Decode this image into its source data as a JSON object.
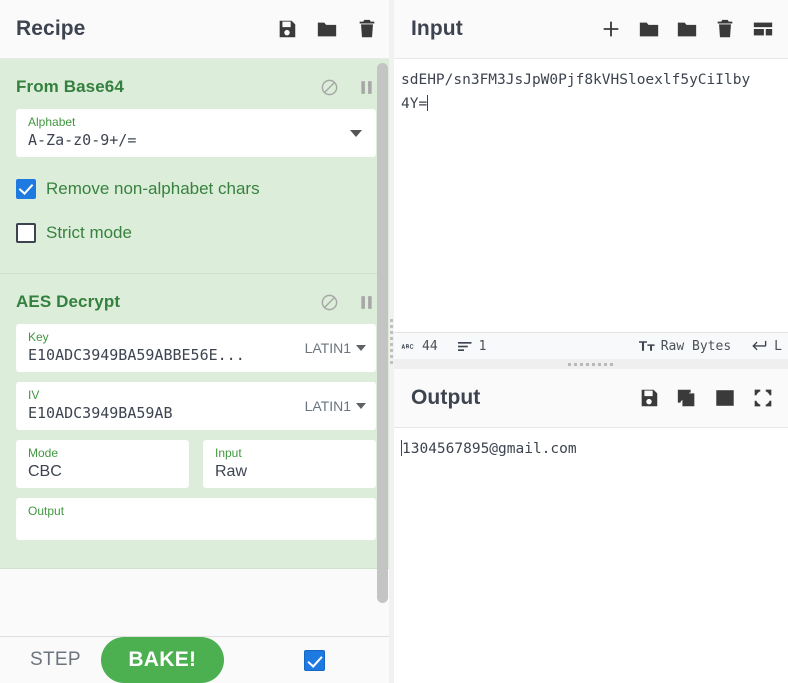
{
  "recipe": {
    "title": "Recipe",
    "title_icons": [
      {
        "name": "save-recipe-icon",
        "glyph": "floppy"
      },
      {
        "name": "load-recipe-icon",
        "glyph": "folder"
      },
      {
        "name": "clear-recipe-icon",
        "glyph": "trash"
      }
    ],
    "operations": [
      {
        "name": "From Base64",
        "disable_label": "disable-operation-icon",
        "pause_label": "breakpoint-icon",
        "args": [
          {
            "type": "select",
            "label": "Alphabet",
            "value": "A-Za-z0-9+/="
          },
          {
            "type": "checkbox",
            "label": "Remove non-alphabet chars",
            "checked": true
          },
          {
            "type": "checkbox",
            "label": "Strict mode",
            "checked": false
          }
        ]
      },
      {
        "name": "AES Decrypt",
        "disable_label": "disable-operation-icon",
        "pause_label": "breakpoint-icon",
        "args": [
          {
            "type": "toggle-string",
            "label": "Key",
            "value": "E10ADC3949BA59ABBE56E...",
            "encoding": "LATIN1"
          },
          {
            "type": "toggle-string",
            "label": "IV",
            "value": "E10ADC3949BA59AB",
            "encoding": "LATIN1"
          },
          {
            "type": "select",
            "label": "Mode",
            "value": "CBC"
          },
          {
            "type": "select",
            "label": "Input",
            "value": "Raw"
          },
          {
            "type": "select",
            "label": "Output",
            "value": ""
          }
        ]
      }
    ]
  },
  "controls": {
    "step_label": "STEP",
    "bake_label": "BAKE!",
    "auto_bake_name": "auto-bake-checkbox",
    "auto_bake_checked": true
  },
  "input": {
    "title": "Input",
    "title_icons": [
      {
        "name": "add-input-tab-icon",
        "glyph": "plus"
      },
      {
        "name": "open-file-icon",
        "glyph": "folder"
      },
      {
        "name": "open-folder-as-input-icon",
        "glyph": "folder-arrow"
      },
      {
        "name": "clear-io-icon",
        "glyph": "trash"
      },
      {
        "name": "input-tabs-layout-icon",
        "glyph": "panels"
      }
    ],
    "text_line_1": "sdEHP/sn3FM3JsJpW0Pjf8kVHSloexlf5yCiIlby",
    "text_line_2": "4Y=",
    "status": {
      "length_icon": "abc-icon",
      "length": "44",
      "lines_icon": "lines-icon",
      "lines": "1",
      "input_type_icon": "font-size-icon",
      "input_type": "Raw Bytes",
      "line_ending_icon": "line-ending-icon",
      "line_ending": "L"
    }
  },
  "output": {
    "title": "Output",
    "title_icons": [
      {
        "name": "save-output-icon",
        "glyph": "floppy"
      },
      {
        "name": "copy-output-icon",
        "glyph": "copy"
      },
      {
        "name": "replace-input-with-output-icon",
        "glyph": "box-up-arrow"
      },
      {
        "name": "maximise-output-icon",
        "glyph": "expand"
      }
    ],
    "text": "1304567895@gmail.com"
  },
  "colors": {
    "operation_bg": "#dcedda",
    "operation_title": "#34803f",
    "bake_green": "#4caf50",
    "checkbox_blue": "#1e7ae0",
    "pane_bg": "#fafafa"
  }
}
